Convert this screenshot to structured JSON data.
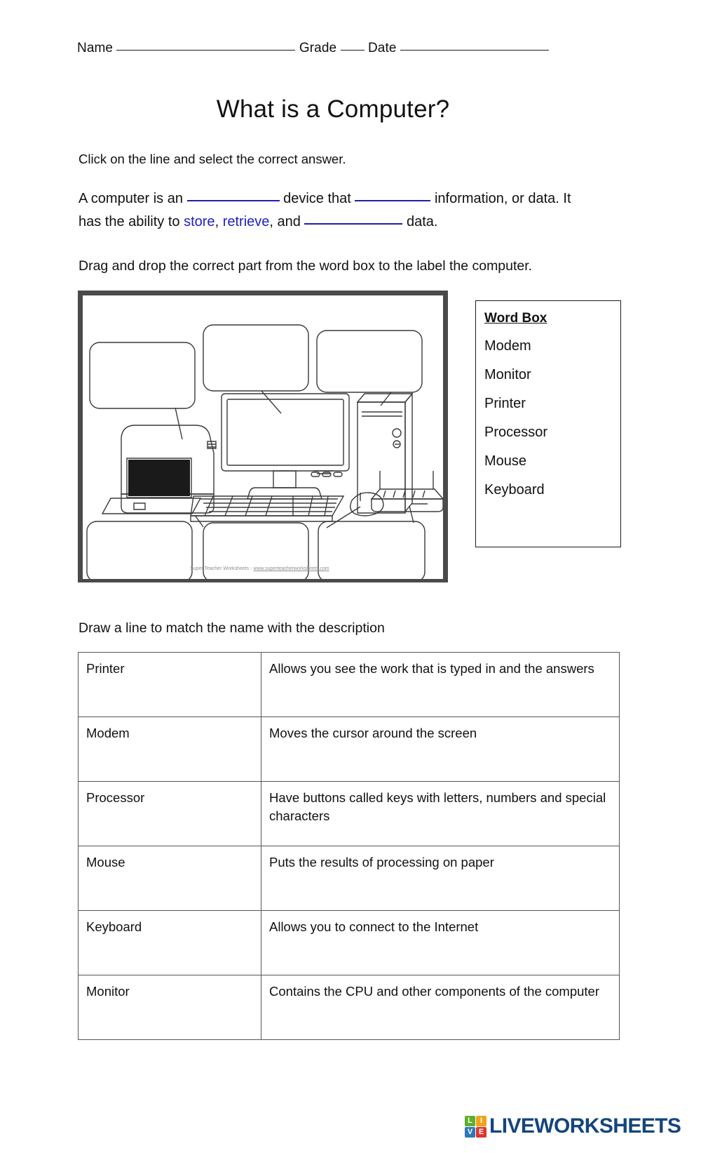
{
  "header": {
    "name_label": "Name",
    "grade_label": "Grade",
    "date_label": "Date",
    "name_value": "",
    "grade_value": "",
    "date_value": ""
  },
  "title": "What is a Computer?",
  "section1": {
    "instruction": "Click on the line and select the correct answer.",
    "sentence_parts": {
      "p1": "A computer is an",
      "p2": "device that",
      "p3": "information, or data. It has the ability to",
      "link1": "store",
      "sep1": ",",
      "link2": "retrieve",
      "sep2": ", and",
      "p4": "data."
    },
    "blanks": [
      "",
      "",
      ""
    ]
  },
  "section2": {
    "instruction": "Drag and drop the correct part from the word box to the label the computer.",
    "diagram": {
      "credit_text": "Super Teacher Worksheets - ",
      "credit_link": "www.superteacherworksheets.com",
      "callouts": [
        "",
        "",
        "",
        "",
        "",
        ""
      ]
    },
    "wordbox": {
      "title": "Word Box",
      "items": [
        "Modem",
        "Monitor",
        "Printer",
        "Processor",
        "Mouse",
        "Keyboard"
      ]
    }
  },
  "section3": {
    "instruction": "Draw a line to match the name with the description",
    "rows": [
      {
        "name": "Printer",
        "description": "Allows you see the work that is typed in and the answers"
      },
      {
        "name": "Modem",
        "description": "Moves the cursor around the screen"
      },
      {
        "name": "Processor",
        "description": "Have buttons called keys with letters, numbers and special characters"
      },
      {
        "name": "Mouse",
        "description": "Puts the results of processing on paper"
      },
      {
        "name": "Keyboard",
        "description": "Allows you to connect to the Internet"
      },
      {
        "name": "Monitor",
        "description": "Contains the CPU and other components of the computer"
      }
    ]
  },
  "footer": {
    "logo_tiles": [
      "L",
      "I",
      "V",
      "E"
    ],
    "logo_text": "LIVEWORKSHEETS",
    "colors": {
      "tile_l": "#5fae2e",
      "tile_i": "#f0a31b",
      "tile_v": "#2f77bd",
      "tile_e": "#e0342b",
      "logo_text": "#14457d",
      "blank_blue": "#1f1fa8",
      "link_blue": "#1f1fbe"
    }
  }
}
